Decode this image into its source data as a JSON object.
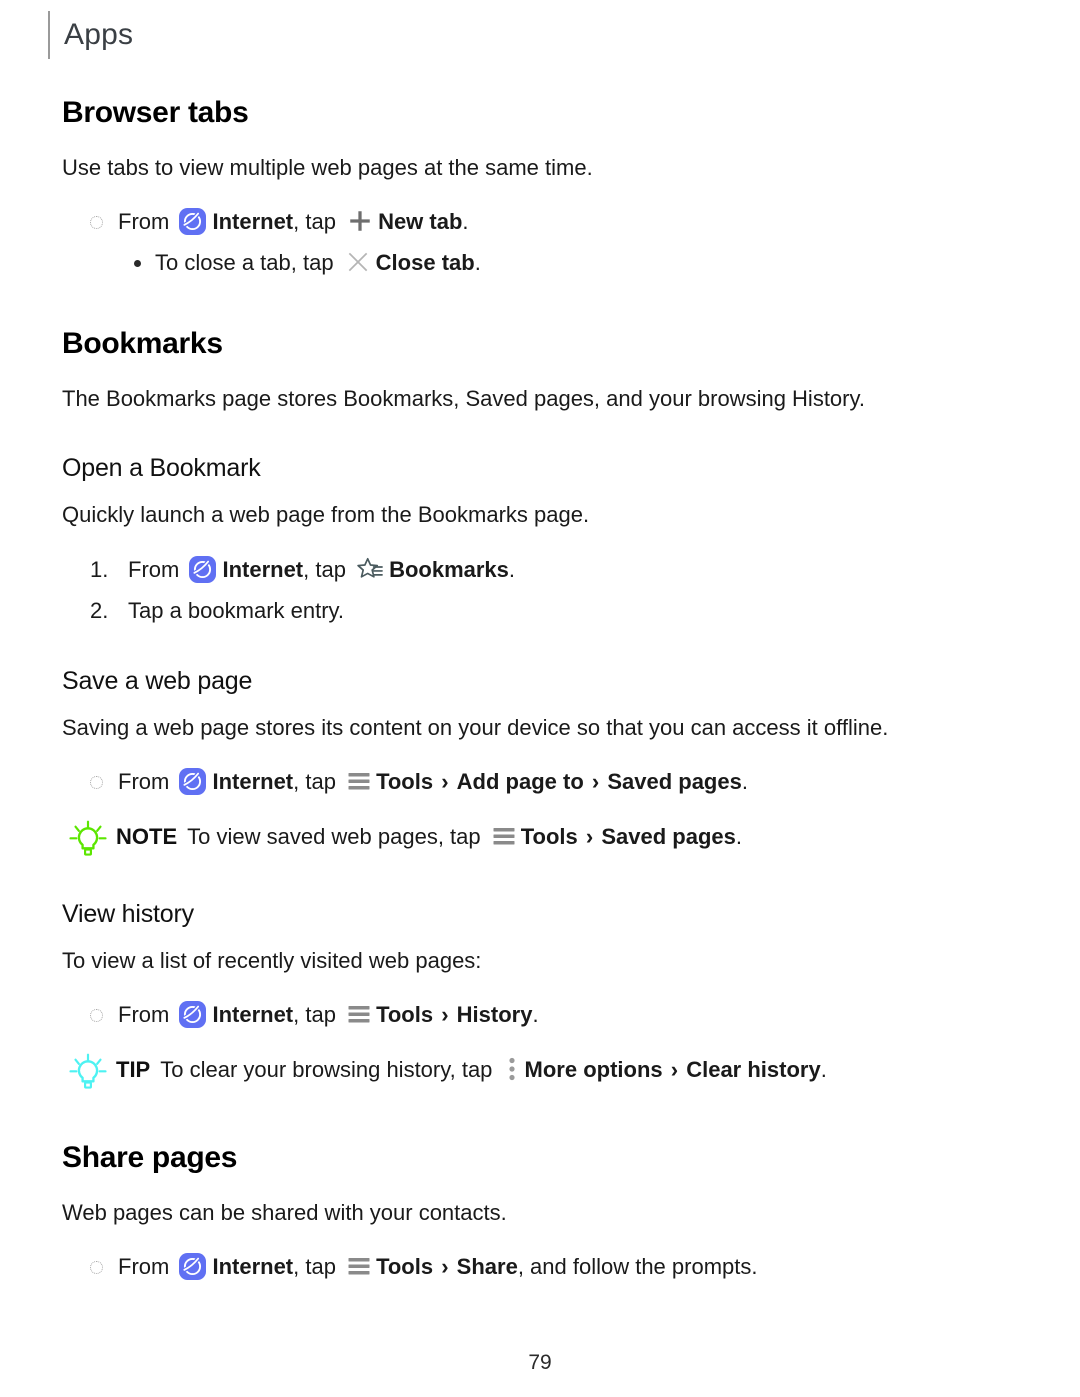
{
  "header": {
    "title": "Apps"
  },
  "page": {
    "number": "79"
  },
  "icons": {
    "internet": "internet-app-icon",
    "plus": "plus-icon",
    "close": "close-x-icon",
    "bookmarks": "bookmarks-star-icon",
    "tools": "tools-hamburger-icon",
    "more_options": "more-options-vertical-dots-icon",
    "bulb_note": "lightbulb-icon",
    "bulb_tip": "lightbulb-icon"
  },
  "colors": {
    "internet_icon_bg": "#6070F3",
    "internet_icon_fg": "#FFFFFF",
    "note_bulb": "#5CE600",
    "tip_bulb": "#4DF2F2",
    "tools_icon": "#8A8A8A",
    "plus_icon": "#6E6E6E",
    "close_icon": "#B5B5B5",
    "bookmark_icon": "#4A5A5E",
    "more_options_icon": "#9A9A9A",
    "header_rule": "#9A9A9A",
    "text": "#1A1A1A"
  },
  "sections": [
    {
      "id": "browser-tabs",
      "title": "Browser tabs",
      "intro": "Use tabs to view multiple web pages at the same time.",
      "items": [
        {
          "level": 1,
          "marker": "ring",
          "parts": [
            {
              "t": "From ",
              "style": "normal"
            },
            {
              "t": "internet-icon",
              "style": "icon"
            },
            {
              "t": "Internet",
              "style": "bold"
            },
            {
              "t": ", tap ",
              "style": "normal"
            },
            {
              "t": "plus-icon",
              "style": "icon"
            },
            {
              "t": "New tab",
              "style": "bold"
            },
            {
              "t": ".",
              "style": "normal"
            }
          ]
        },
        {
          "level": 2,
          "marker": "dot",
          "parts": [
            {
              "t": "To close a tab, tap ",
              "style": "normal"
            },
            {
              "t": "close-icon",
              "style": "icon"
            },
            {
              "t": "Close tab",
              "style": "bold"
            },
            {
              "t": ".",
              "style": "normal"
            }
          ]
        }
      ]
    },
    {
      "id": "bookmarks",
      "title": "Bookmarks",
      "intro": "The Bookmarks page stores Bookmarks, Saved pages, and your browsing History.",
      "subsections": [
        {
          "id": "open-a-bookmark",
          "title": "Open a Bookmark",
          "intro": "Quickly launch a web page from the Bookmarks page.",
          "items": [
            {
              "level": 1,
              "marker": "num",
              "number": "1.",
              "parts": [
                {
                  "t": "From ",
                  "style": "normal"
                },
                {
                  "t": "internet-icon",
                  "style": "icon"
                },
                {
                  "t": "Internet",
                  "style": "bold"
                },
                {
                  "t": ", tap ",
                  "style": "normal"
                },
                {
                  "t": "bookmarks-icon",
                  "style": "icon"
                },
                {
                  "t": "Bookmarks",
                  "style": "bold"
                },
                {
                  "t": ".",
                  "style": "normal"
                }
              ]
            },
            {
              "level": 1,
              "marker": "num",
              "number": "2.",
              "parts": [
                {
                  "t": "Tap a bookmark entry.",
                  "style": "normal"
                }
              ]
            }
          ]
        },
        {
          "id": "save-a-web-page",
          "title": "Save a web page",
          "intro": "Saving a web page stores its content on your device so that you can access it offline.",
          "items": [
            {
              "level": 1,
              "marker": "ring",
              "parts": [
                {
                  "t": "From ",
                  "style": "normal"
                },
                {
                  "t": "internet-icon",
                  "style": "icon"
                },
                {
                  "t": "Internet",
                  "style": "bold"
                },
                {
                  "t": ", tap ",
                  "style": "normal"
                },
                {
                  "t": "tools-icon",
                  "style": "icon"
                },
                {
                  "t": "Tools",
                  "style": "bold"
                },
                {
                  "t": " › ",
                  "style": "chevron"
                },
                {
                  "t": "Add page to",
                  "style": "bold"
                },
                {
                  "t": " › ",
                  "style": "chevron"
                },
                {
                  "t": "Saved pages",
                  "style": "bold"
                },
                {
                  "t": ".",
                  "style": "normal"
                }
              ]
            }
          ],
          "callout": {
            "type": "NOTE",
            "label": "NOTE",
            "parts": [
              {
                "t": "To view saved web pages, tap ",
                "style": "normal"
              },
              {
                "t": "tools-icon",
                "style": "icon"
              },
              {
                "t": "Tools",
                "style": "bold"
              },
              {
                "t": " › ",
                "style": "chevron"
              },
              {
                "t": "Saved pages",
                "style": "bold"
              },
              {
                "t": ".",
                "style": "normal"
              }
            ]
          }
        },
        {
          "id": "view-history",
          "title": "View history",
          "intro": "To view a list of recently visited web pages:",
          "items": [
            {
              "level": 1,
              "marker": "ring",
              "parts": [
                {
                  "t": "From ",
                  "style": "normal"
                },
                {
                  "t": "internet-icon",
                  "style": "icon"
                },
                {
                  "t": "Internet",
                  "style": "bold"
                },
                {
                  "t": ", tap ",
                  "style": "normal"
                },
                {
                  "t": "tools-icon",
                  "style": "icon"
                },
                {
                  "t": "Tools",
                  "style": "bold"
                },
                {
                  "t": " › ",
                  "style": "chevron"
                },
                {
                  "t": "History",
                  "style": "bold"
                },
                {
                  "t": ".",
                  "style": "normal"
                }
              ]
            }
          ],
          "callout": {
            "type": "TIP",
            "label": "TIP",
            "parts": [
              {
                "t": "To clear your browsing history, tap ",
                "style": "normal"
              },
              {
                "t": "more-options-icon",
                "style": "icon"
              },
              {
                "t": "More options",
                "style": "bold"
              },
              {
                "t": " › ",
                "style": "chevron"
              },
              {
                "t": "Clear history",
                "style": "bold"
              },
              {
                "t": ".",
                "style": "normal"
              }
            ]
          }
        }
      ]
    },
    {
      "id": "share-pages",
      "title": "Share pages",
      "intro": "Web pages can be shared with your contacts.",
      "items": [
        {
          "level": 1,
          "marker": "ring",
          "parts": [
            {
              "t": "From ",
              "style": "normal"
            },
            {
              "t": "internet-icon",
              "style": "icon"
            },
            {
              "t": "Internet",
              "style": "bold"
            },
            {
              "t": ", tap ",
              "style": "normal"
            },
            {
              "t": "tools-icon",
              "style": "icon"
            },
            {
              "t": "Tools",
              "style": "bold"
            },
            {
              "t": " › ",
              "style": "chevron"
            },
            {
              "t": "Share",
              "style": "bold"
            },
            {
              "t": ", and follow the prompts.",
              "style": "normal"
            }
          ]
        }
      ]
    }
  ]
}
